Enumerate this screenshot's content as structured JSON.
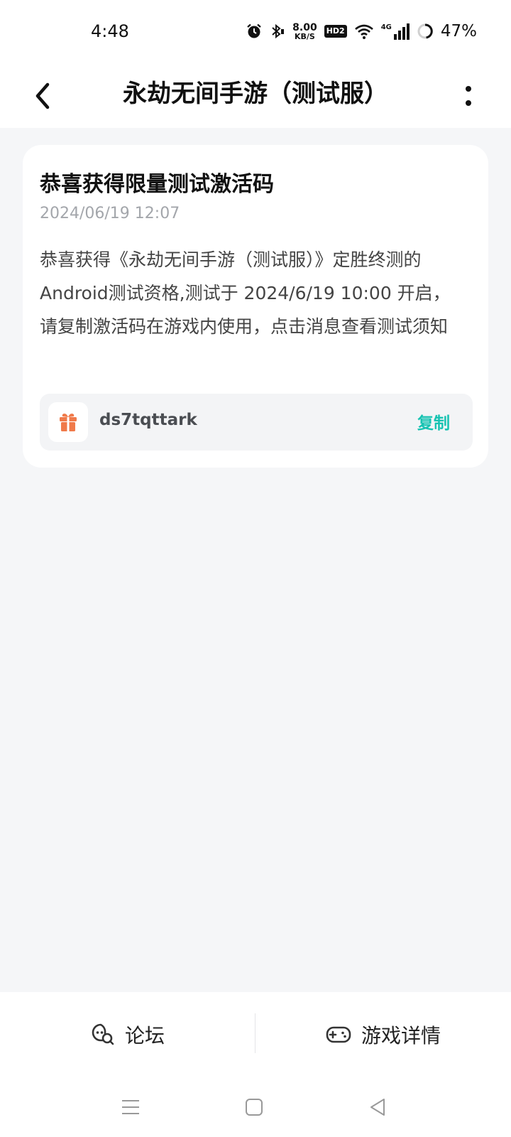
{
  "status": {
    "time": "4:48",
    "speed_value": "8.00",
    "speed_unit": "KB/S",
    "hd_label": "HD2",
    "network_label": "4G",
    "battery": "47%"
  },
  "header": {
    "title": "永劫无间手游（测试服）"
  },
  "message": {
    "title": "恭喜获得限量测试激活码",
    "timestamp": "2024/06/19 12:07",
    "body": "恭喜获得《永劫无间手游（测试服）》定胜终测的Android测试资格,测试于 2024/6/19 10:00 开启，请复制激活码在游戏内使用，点击消息查看测试须知",
    "code": "ds7tqttark",
    "copy_label": "复制"
  },
  "bottom_tabs": [
    {
      "label": "论坛",
      "icon": "forum-icon"
    },
    {
      "label": "游戏详情",
      "icon": "gamepad-icon"
    }
  ],
  "nav": {
    "icons": [
      "menu-icon",
      "home-icon",
      "back-triangle-icon"
    ]
  },
  "colors": {
    "accent": "#17c3b2",
    "gift": "#f07a4a",
    "background": "#f5f6f8"
  }
}
